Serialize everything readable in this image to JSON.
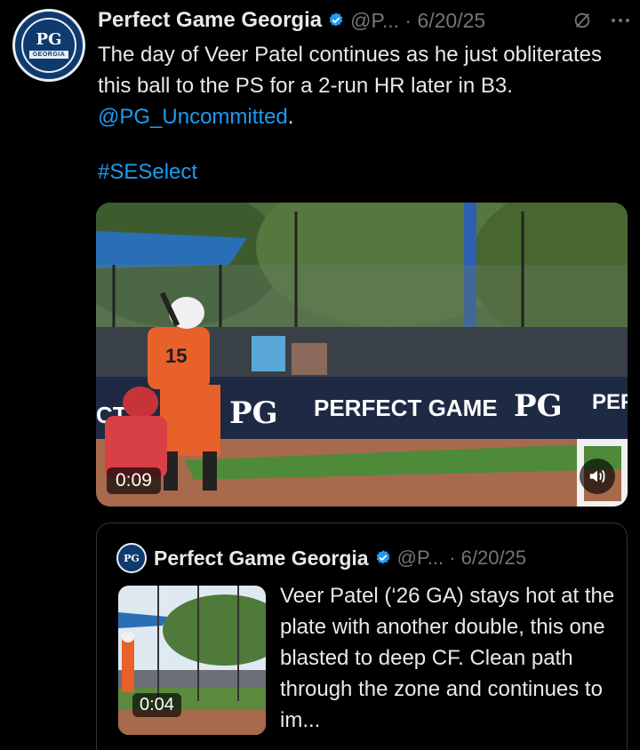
{
  "post": {
    "author_name": "Perfect Game Georgia",
    "handle_date": "@P... · 6/20/25",
    "avatar_text": "PG",
    "avatar_badge": "GEORGIA",
    "text_before_link": "The day of Veer Patel continues as he just obliterates this ball to the PS for a 2-run HR later in B3. ",
    "mention": "@PG_Uncommitted",
    "text_after_link": ".",
    "hashtag": "#SESelect",
    "video": {
      "duration": "0:09",
      "banner_text": "PERFECT GAME",
      "banner_text_2": "PEF",
      "banner_text_left": "CT",
      "jersey_number": "15"
    }
  },
  "quoted_post": {
    "author_name": "Perfect Game Georgia",
    "handle_date": "@P... · 6/20/25",
    "avatar_text": "PG",
    "text": "Veer Patel (‘26 GA) stays hot at the plate with another double, this one blasted to deep CF. Clean path through the zone and continues to im...",
    "video_duration": "0:04"
  },
  "icons": {
    "verified": "verified-badge-icon",
    "grok": "grok-icon",
    "more": "more-icon",
    "mute": "volume-icon"
  },
  "colors": {
    "background": "#000000",
    "text": "#e7e9ea",
    "secondary": "#71767b",
    "link": "#1d9bf0",
    "brand": "#0f3a6e"
  }
}
